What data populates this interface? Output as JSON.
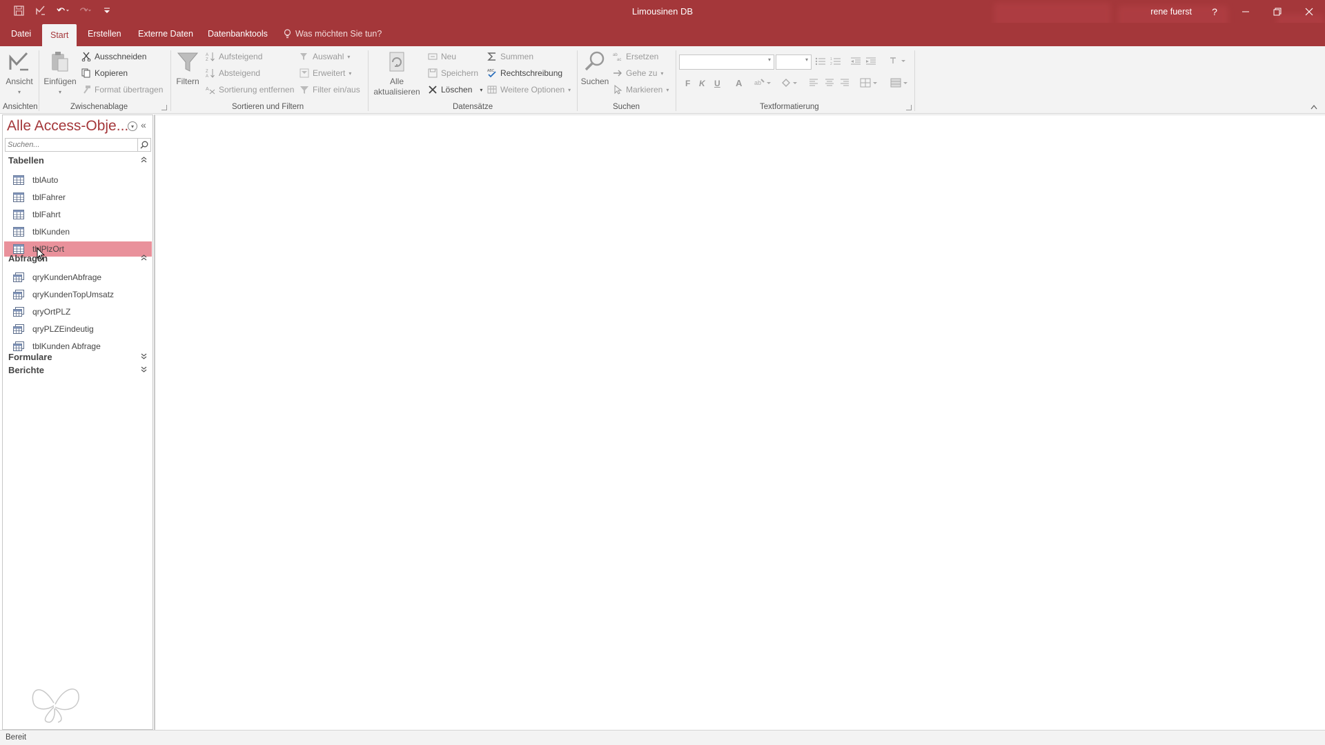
{
  "titlebar": {
    "title": "Limousinen DB",
    "user": "rene fuerst",
    "help": "?"
  },
  "tabs": [
    "Datei",
    "Start",
    "Erstellen",
    "Externe Daten",
    "Datenbanktools"
  ],
  "active_tab": "Start",
  "tellme": "Was möchten Sie tun?",
  "ribbon": {
    "ansichten": {
      "view": "Ansicht",
      "label": "Ansichten"
    },
    "clipboard": {
      "paste": "Einfügen",
      "cut": "Ausschneiden",
      "copy": "Kopieren",
      "format_painter": "Format übertragen",
      "label": "Zwischenablage"
    },
    "sort": {
      "filter": "Filtern",
      "asc": "Aufsteigend",
      "desc": "Absteigend",
      "remove_sort": "Sortierung entfernen",
      "selection": "Auswahl",
      "advanced": "Erweitert",
      "toggle_filter": "Filter ein/aus",
      "label": "Sortieren und Filtern"
    },
    "records": {
      "refresh_line1": "Alle",
      "refresh_line2": "aktualisieren",
      "new": "Neu",
      "save": "Speichern",
      "delete": "Löschen",
      "totals": "Summen",
      "spelling": "Rechtschreibung",
      "more": "Weitere Optionen",
      "label": "Datensätze"
    },
    "find": {
      "find": "Suchen",
      "replace": "Ersetzen",
      "goto": "Gehe zu",
      "select": "Markieren",
      "label": "Suchen"
    },
    "text": {
      "bold": "F",
      "italic": "K",
      "underline": "U",
      "font_color": "A",
      "label": "Textformatierung"
    }
  },
  "nav": {
    "title": "Alle Access-Obje...",
    "search_placeholder": "Suchen...",
    "sections": [
      {
        "name": "Tabellen",
        "items": [
          "tblAuto",
          "tblFahrer",
          "tblFahrt",
          "tblKunden",
          "tblPlzOrt"
        ]
      },
      {
        "name": "Abfragen",
        "items": [
          "qryKundenAbfrage",
          "qryKundenTopUmsatz",
          "qryOrtPLZ",
          "qryPLZEindeutig",
          "tblKunden Abfrage"
        ]
      },
      {
        "name": "Formulare",
        "items": []
      },
      {
        "name": "Berichte",
        "items": []
      }
    ],
    "selected_item": "tblPlzOrt"
  },
  "status": "Bereit",
  "colors": {
    "accent": "#a4373a",
    "selection": "#e9919b",
    "ribbon_bg": "#f3f3f3"
  }
}
